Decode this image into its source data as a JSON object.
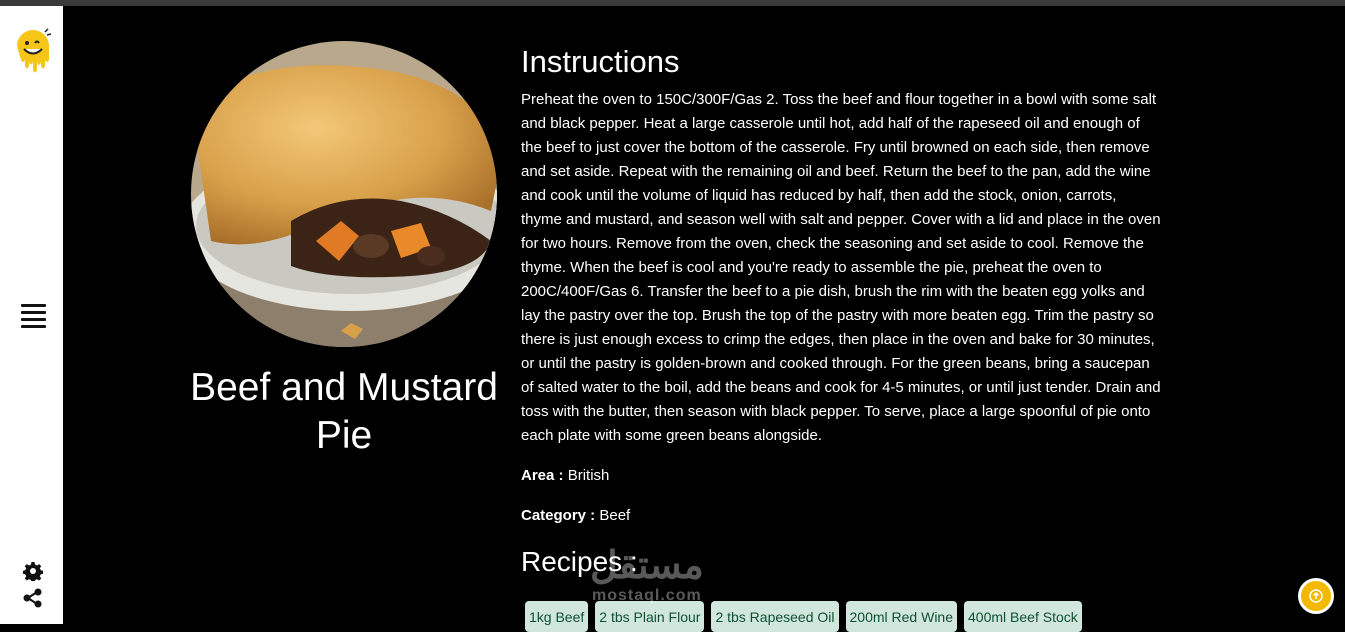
{
  "sidebar": {
    "logo_icon": "smiley-drip-logo-icon",
    "menu_icon": "hamburger-menu-icon",
    "settings_icon": "gear-icon",
    "share_icon": "share-icon"
  },
  "meal": {
    "title": "Beef and Mustard Pie",
    "image_icon": "beef-pie-photo"
  },
  "instructions": {
    "heading": "Instructions",
    "text": "Preheat the oven to 150C/300F/Gas 2. Toss the beef and flour together in a bowl with some salt and black pepper. Heat a large casserole until hot, add half of the rapeseed oil and enough of the beef to just cover the bottom of the casserole. Fry until browned on each side, then remove and set aside. Repeat with the remaining oil and beef. Return the beef to the pan, add the wine and cook until the volume of liquid has reduced by half, then add the stock, onion, carrots, thyme and mustard, and season well with salt and pepper. Cover with a lid and place in the oven for two hours. Remove from the oven, check the seasoning and set aside to cool. Remove the thyme. When the beef is cool and you're ready to assemble the pie, preheat the oven to 200C/400F/Gas 6. Transfer the beef to a pie dish, brush the rim with the beaten egg yolks and lay the pastry over the top. Brush the top of the pastry with more beaten egg. Trim the pastry so there is just enough excess to crimp the edges, then place in the oven and bake for 30 minutes, or until the pastry is golden-brown and cooked through. For the green beans, bring a saucepan of salted water to the boil, add the beans and cook for 4-5 minutes, or until just tender. Drain and toss with the butter, then season with black pepper. To serve, place a large spoonful of pie onto each plate with some green beans alongside."
  },
  "area": {
    "label": "Area :",
    "value": "British"
  },
  "category": {
    "label": "Category :",
    "value": "Beef"
  },
  "recipes": {
    "heading": "Recipes :",
    "items": [
      "1kg Beef",
      "2 tbs Plain Flour",
      "2 tbs Rapeseed Oil",
      "200ml Red Wine",
      "400ml Beef Stock"
    ]
  },
  "watermark": {
    "arabic": "مستقل",
    "latin": "mostaql.com"
  },
  "scroll_top_icon": "arrow-up-icon",
  "colors": {
    "accent": "#f5b800",
    "chip_bg": "#d1e7dd",
    "chip_text": "#0f5132",
    "background": "#000000"
  }
}
